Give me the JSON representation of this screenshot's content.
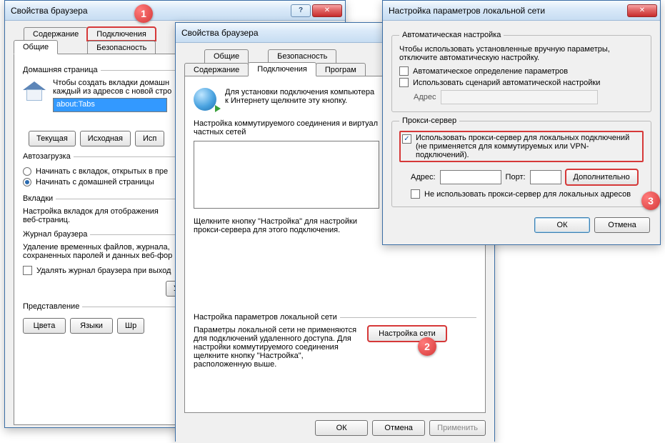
{
  "markers": {
    "m1": "1",
    "m2": "2",
    "m3": "3"
  },
  "win1": {
    "title": "Свойства браузера",
    "help": "?",
    "close": "✕",
    "tabs_row1": {
      "content": "Содержание",
      "connections": "Подключения"
    },
    "tabs_row2": {
      "general": "Общие",
      "security": "Безопасность"
    },
    "home_group": "Домашняя страница",
    "home_text1": "Чтобы создать вкладки домашн",
    "home_text2": "каждый из адресов с новой стро",
    "home_url": "about:Tabs",
    "btn_current": "Текущая",
    "btn_default": "Исходная",
    "btn_use": "Исп",
    "autoload_group": "Автозагрузка",
    "autoload_opt1": "Начинать с вкладок, открытых в пре",
    "autoload_opt2": "Начинать с домашней страницы",
    "tabs_group": "Вкладки",
    "tabs_desc": "Настройка вкладок для отображения веб-страниц.",
    "journal_group": "Журнал браузера",
    "journal_desc": "Удаление временных файлов, журнала, сохраненных паролей и данных веб-фор",
    "journal_chk": "Удалять журнал браузера при выход",
    "btn_del": "Удал",
    "present_group": "Представление",
    "btn_colors": "Цвета",
    "btn_lang": "Языки",
    "btn_fonts": "Шр"
  },
  "win2": {
    "title": "Свойства браузера",
    "tabs_row1": {
      "general": "Общие",
      "security": "Безопасность"
    },
    "tabs_row2": {
      "content": "Содержание",
      "connections": "Подключения",
      "programs": "Програм"
    },
    "conn_text1": "Для установки подключения компьютера",
    "conn_text2": "к Интернету щелкните эту кнопку.",
    "dial_text": "Настройка коммутируемого соединения и виртуал частных сетей",
    "dial_hint1": "Щелкните кнопку \"Настройка\" для настройки",
    "dial_hint2": "прокси-сервера для этого подключения.",
    "lan_group": "Настройка параметров локальной сети",
    "lan_desc1": "Параметры локальной сети не применяются для подключений удаленного доступа. Для настройки коммутируемого соединения щелкните кнопку \"Настройка\", расположенную выше.",
    "btn_lan": "Настройка сети",
    "btn_ok": "ОК",
    "btn_cancel": "Отмена",
    "btn_apply": "Применить"
  },
  "win3": {
    "title": "Настройка параметров локальной сети",
    "close": "✕",
    "auto_group": "Автоматическая настройка",
    "auto_desc": "Чтобы использовать установленные вручную параметры, отключите автоматическую настройку.",
    "auto_chk1": "Автоматическое определение параметров",
    "auto_chk2": "Использовать сценарий автоматической настройки",
    "addr_label": "Адрес",
    "proxy_group": "Прокси-сервер",
    "proxy_chk": "Использовать прокси-сервер для локальных подключений (не применяется для коммутируемых или VPN-подключений).",
    "addr2_label": "Адрес:",
    "port_label": "Порт:",
    "btn_advanced": "Дополнительно",
    "bypass_chk": "Не использовать прокси-сервер для локальных адресов",
    "btn_ok": "ОК",
    "btn_cancel": "Отмена"
  }
}
